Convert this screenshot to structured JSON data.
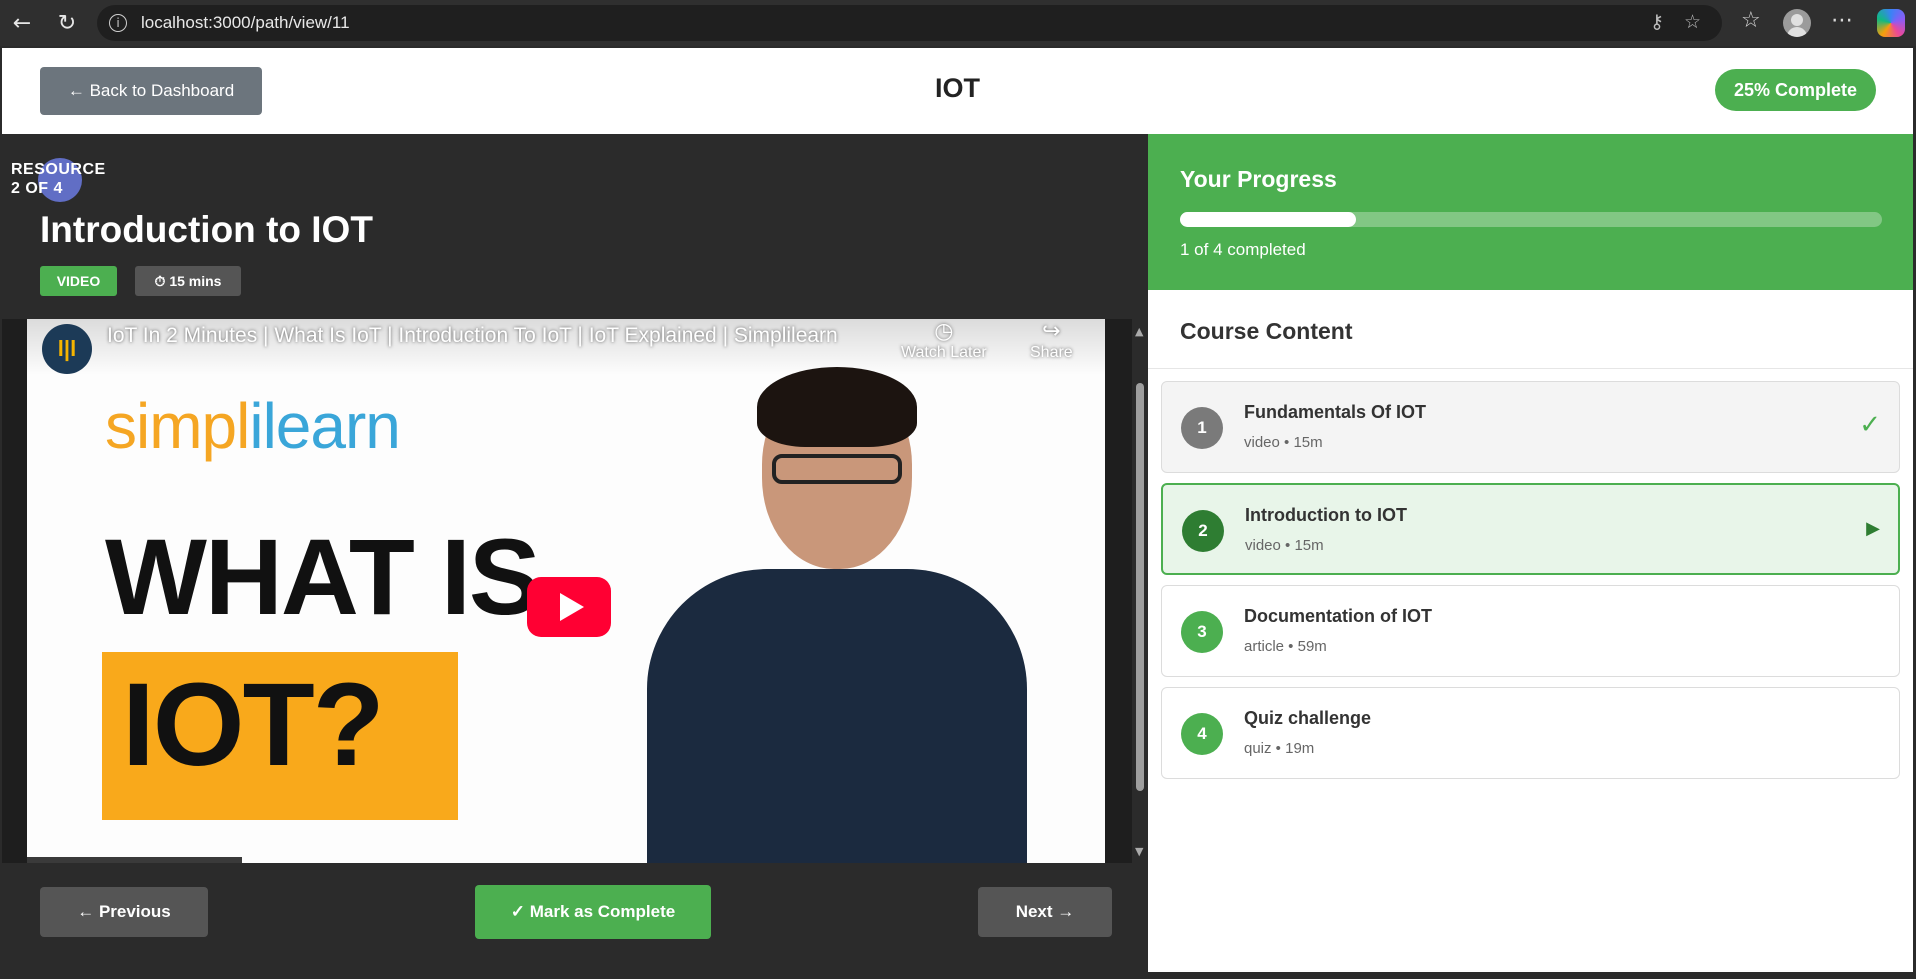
{
  "browser": {
    "url": "localhost:3000/path/view/11"
  },
  "header": {
    "back_label": "← Back to Dashboard",
    "title": "IOT",
    "completion_badge": "25% Complete"
  },
  "resource": {
    "counter_line1": "RESOURCE",
    "counter_line2": "2 OF 4",
    "title": "Introduction to IOT",
    "type_badge": "VIDEO",
    "duration_badge": "⏱ 15 mins"
  },
  "video": {
    "channel_initial": "l|l",
    "title": "IoT In 2 Minutes | What Is IoT | Introduction To IoT | IoT Explained | Simplilearn",
    "watch_later": "Watch Later",
    "share": "Share",
    "brand_part1": "simpl",
    "brand_part2": "ilearn",
    "headline_1": "WHAT IS",
    "headline_2": "IOT?"
  },
  "footer": {
    "previous_label": "← Previous",
    "complete_label": "✓ Mark as Complete",
    "next_label": "Next →"
  },
  "progress": {
    "heading": "Your Progress",
    "fraction": 0.25,
    "text": "1 of 4 completed"
  },
  "course_content": {
    "heading": "Course Content",
    "items": [
      {
        "number": "1",
        "title": "Fundamentals Of IOT",
        "meta": "video • 15m",
        "status": "completed",
        "status_icon": "✓"
      },
      {
        "number": "2",
        "title": "Introduction to IOT",
        "meta": "video • 15m",
        "status": "active",
        "status_icon": "▶"
      },
      {
        "number": "3",
        "title": "Documentation of IOT",
        "meta": "article • 59m",
        "status": "pending",
        "status_icon": ""
      },
      {
        "number": "4",
        "title": "Quiz challenge",
        "meta": "quiz • 19m",
        "status": "pending",
        "status_icon": ""
      }
    ]
  },
  "colors": {
    "accent": "#4caf50",
    "dark_panel": "#2b2b2b",
    "button_gray": "#6c757d"
  }
}
